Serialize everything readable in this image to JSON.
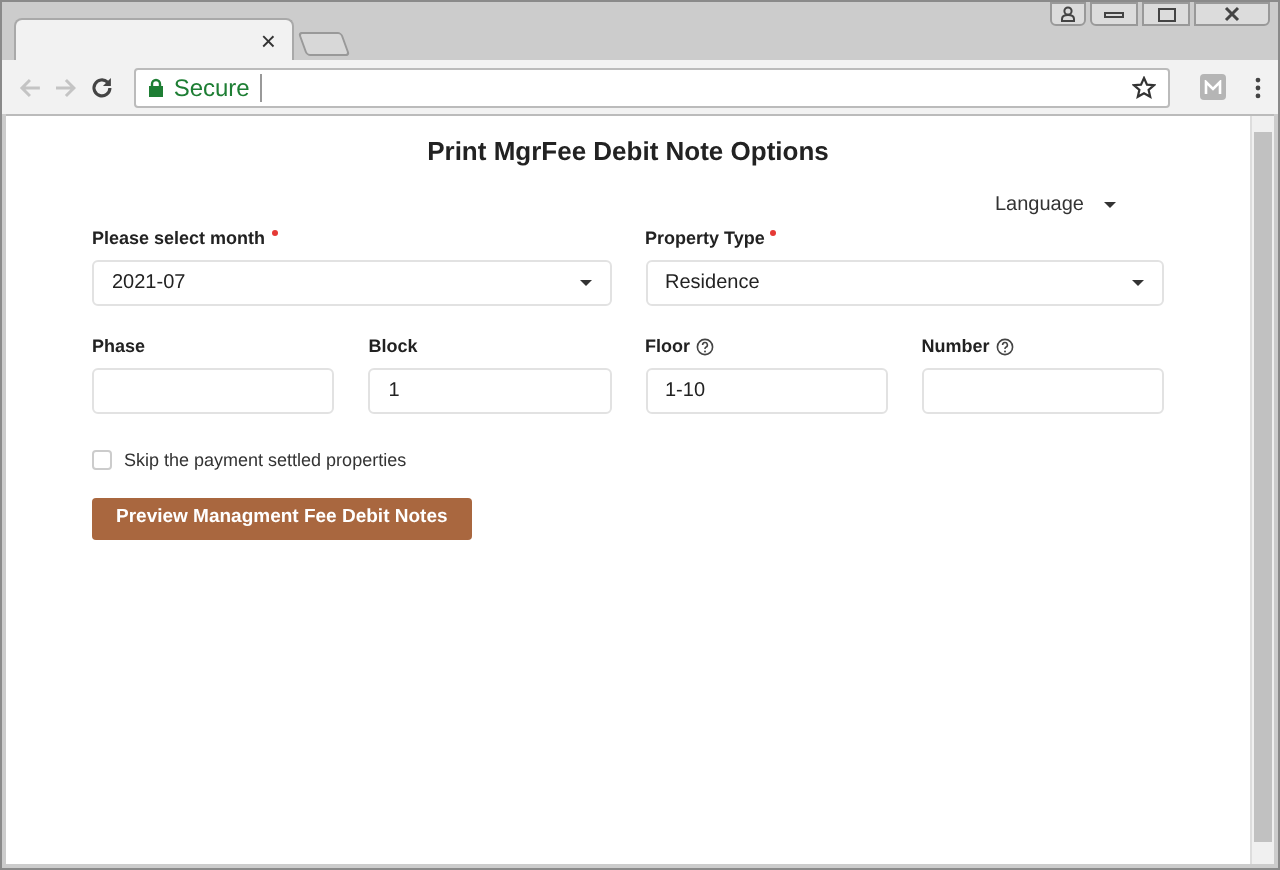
{
  "browser": {
    "tab": {
      "close": "×"
    },
    "address": {
      "security": "Secure"
    }
  },
  "page": {
    "title": "Print MgrFee Debit Note Options",
    "language": "Language",
    "selects": [
      {
        "label": "Please select month",
        "required": true,
        "value": "2021-07"
      },
      {
        "label": "Property Type",
        "required": true,
        "value": "Residence"
      }
    ],
    "inputs": [
      {
        "label": "Phase",
        "help": false
      },
      {
        "label": "Block",
        "help": false,
        "value": "1"
      },
      {
        "label": "Floor",
        "help": true,
        "value": "1-10"
      },
      {
        "label": "Number",
        "help": true
      }
    ],
    "checkbox": {
      "label": "Skip the payment settled properties",
      "checked": false
    },
    "button": "Preview Managment Fee Debit Notes"
  }
}
